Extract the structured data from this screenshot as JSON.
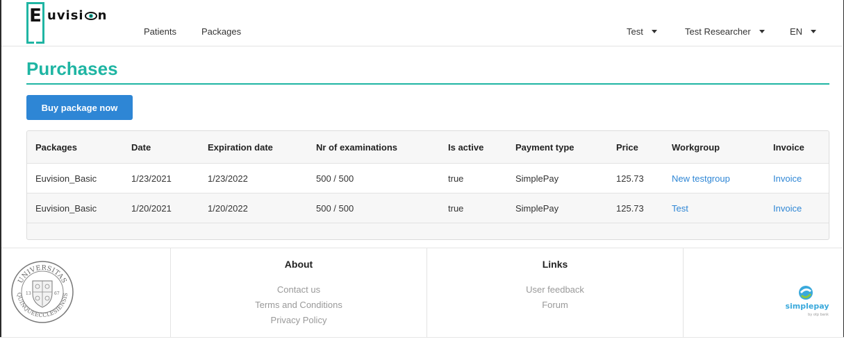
{
  "brand": {
    "logo_letter": "E",
    "logo_text_before": "uvisi",
    "logo_text_after": "n"
  },
  "nav": {
    "links": [
      "Patients",
      "Packages"
    ],
    "dropdowns": [
      "Test",
      "Test Researcher",
      "EN"
    ]
  },
  "page": {
    "title": "Purchases",
    "buy_button": "Buy package now"
  },
  "table": {
    "headers": [
      "Packages",
      "Date",
      "Expiration date",
      "Nr of examinations",
      "Is active",
      "Payment type",
      "Price",
      "Workgroup",
      "Invoice"
    ],
    "rows": [
      [
        "Euvision_Basic",
        "1/23/2021",
        "1/23/2022",
        "500 / 500",
        "true",
        "SimplePay",
        "125.73",
        "New testgroup",
        "Invoice"
      ],
      [
        "Euvision_Basic",
        "1/20/2021",
        "1/20/2022",
        "500 / 500",
        "true",
        "SimplePay",
        "125.73",
        "Test",
        "Invoice"
      ]
    ]
  },
  "footer": {
    "about": {
      "title": "About",
      "links": [
        "Contact us",
        "Terms and Conditions",
        "Privacy Policy"
      ]
    },
    "links": {
      "title": "Links",
      "links": [
        "User feedback",
        "Forum"
      ]
    },
    "seal_text": "UNIVERSITAS QUINQUEECCLESIENSIS",
    "seal_years": [
      "13",
      "67"
    ],
    "payment_logo": "simplepay",
    "payment_sub": "by otp bank"
  },
  "colors": {
    "accent": "#1fb5a3",
    "button": "#2e86d5",
    "link": "#2e86d5"
  }
}
